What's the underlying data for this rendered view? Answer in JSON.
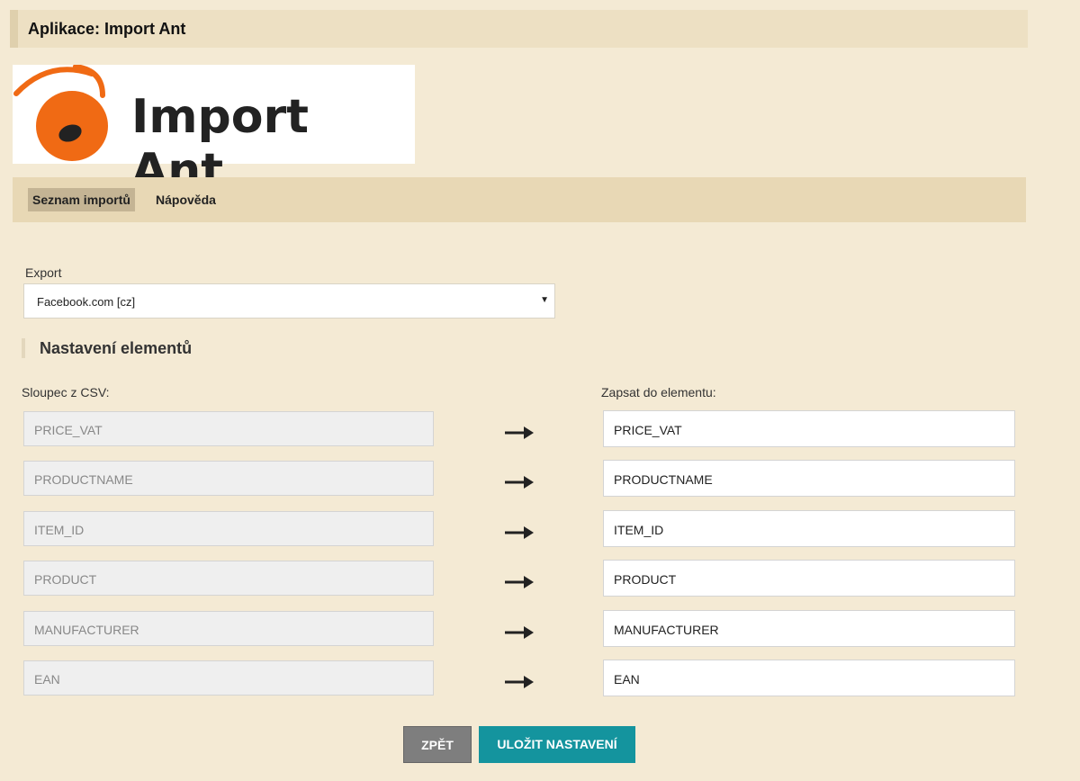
{
  "header": {
    "title": "Aplikace: Import Ant"
  },
  "logo": {
    "text": "Import Ant",
    "accent_color": "#f06a14"
  },
  "nav": {
    "items": [
      {
        "label": "Seznam importů",
        "active": true
      },
      {
        "label": "Nápověda",
        "active": false
      }
    ]
  },
  "export": {
    "label": "Export",
    "selected": "Facebook.com [cz]"
  },
  "section": {
    "title": "Nastavení elementů"
  },
  "columns": {
    "csv_label": "Sloupec z CSV:",
    "element_label": "Zapsat do elementu:"
  },
  "mappings": [
    {
      "csv": "PRICE_VAT",
      "element": "PRICE_VAT"
    },
    {
      "csv": "PRODUCTNAME",
      "element": "PRODUCTNAME"
    },
    {
      "csv": "ITEM_ID",
      "element": "ITEM_ID"
    },
    {
      "csv": "PRODUCT",
      "element": "PRODUCT"
    },
    {
      "csv": "MANUFACTURER",
      "element": "MANUFACTURER"
    },
    {
      "csv": "EAN",
      "element": "EAN"
    }
  ],
  "buttons": {
    "back": "ZPĚT",
    "save": "ULOŽIT NASTAVENÍ"
  },
  "colors": {
    "background": "#f4ead4",
    "primary_button": "#14949e",
    "secondary_button": "#7e7e7e"
  }
}
